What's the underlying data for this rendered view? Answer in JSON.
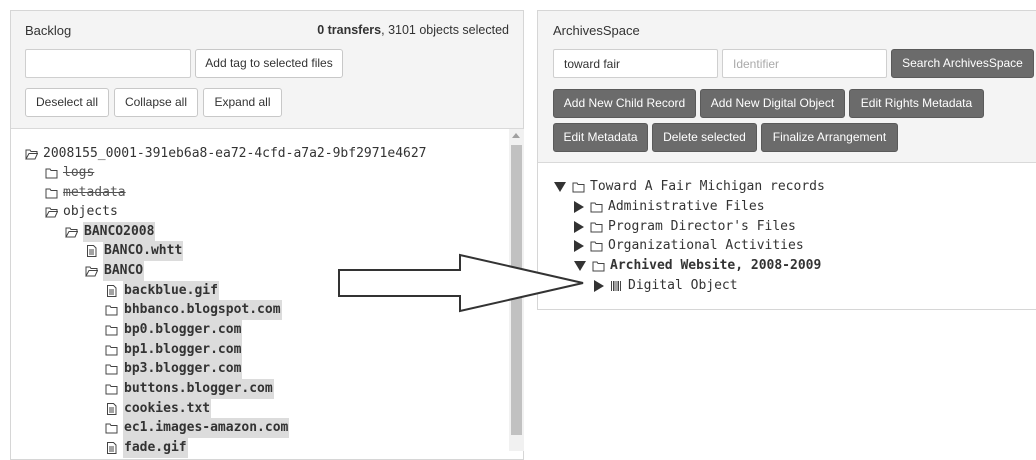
{
  "backlog": {
    "title": "Backlog",
    "status_transfers": "0 transfers",
    "status_selected": ", 3101 objects selected",
    "tag_input_value": "",
    "add_tag_label": "Add tag to selected files",
    "deselect_label": "Deselect all",
    "collapse_label": "Collapse all",
    "expand_label": "Expand all",
    "tree": [
      {
        "label": "2008155_0001-391eb6a8-ea72-4cfd-a7a2-9bf2971e4627",
        "icon": "folder-open-icon"
      },
      {
        "label": "logs",
        "icon": "folder-icon"
      },
      {
        "label": "metadata",
        "icon": "folder-icon"
      },
      {
        "label": "objects",
        "icon": "folder-open-icon"
      },
      {
        "label": "BANCO2008",
        "icon": "folder-open-icon"
      },
      {
        "label": "BANCO.whtt",
        "icon": "file-icon"
      },
      {
        "label": "BANCO",
        "icon": "folder-open-icon"
      },
      {
        "label": "backblue.gif",
        "icon": "file-icon"
      },
      {
        "label": "bhbanco.blogspot.com",
        "icon": "folder-icon"
      },
      {
        "label": "bp0.blogger.com",
        "icon": "folder-icon"
      },
      {
        "label": "bp1.blogger.com",
        "icon": "folder-icon"
      },
      {
        "label": "bp3.blogger.com",
        "icon": "folder-icon"
      },
      {
        "label": "buttons.blogger.com",
        "icon": "folder-icon"
      },
      {
        "label": "cookies.txt",
        "icon": "file-icon"
      },
      {
        "label": "ec1.images-amazon.com",
        "icon": "folder-icon"
      },
      {
        "label": "fade.gif",
        "icon": "file-icon"
      }
    ]
  },
  "archivesspace": {
    "title": "ArchivesSpace",
    "search_value": "toward fair",
    "identifier_placeholder": "Identifier",
    "search_label": "Search ArchivesSpace",
    "add_child_label": "Add New Child Record",
    "add_digital_label": "Add New Digital Object",
    "edit_rights_label": "Edit Rights Metadata",
    "edit_metadata_label": "Edit Metadata",
    "delete_label": "Delete selected",
    "finalize_label": "Finalize Arrangement",
    "tree": [
      {
        "label": "Toward A Fair Michigan records",
        "toggle": "expanded"
      },
      {
        "label": "Administrative Files",
        "toggle": "collapsed"
      },
      {
        "label": "Program Director's Files",
        "toggle": "collapsed"
      },
      {
        "label": "Organizational Activities",
        "toggle": "collapsed"
      },
      {
        "label": "Archived Website, 2008-2009",
        "toggle": "expanded"
      },
      {
        "label": "Digital Object",
        "toggle": "collapsed",
        "icon": "barcode-icon"
      }
    ]
  }
}
